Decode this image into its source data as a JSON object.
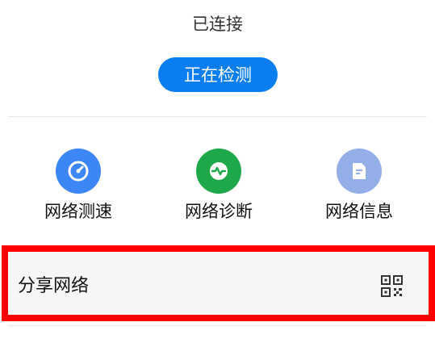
{
  "status": {
    "label": "已连接"
  },
  "detect_button": {
    "label": "正在检测"
  },
  "tools": [
    {
      "label": "网络测速",
      "icon": "speedometer-icon",
      "color": "#3d86f6"
    },
    {
      "label": "网络诊断",
      "icon": "pulse-icon",
      "color": "#1fa84a"
    },
    {
      "label": "网络信息",
      "icon": "document-icon",
      "color": "#94aee8"
    }
  ],
  "share": {
    "label": "分享网络",
    "icon": "qr-code-icon"
  },
  "colors": {
    "accent": "#0a7ef0",
    "highlight": "#ff0000"
  }
}
